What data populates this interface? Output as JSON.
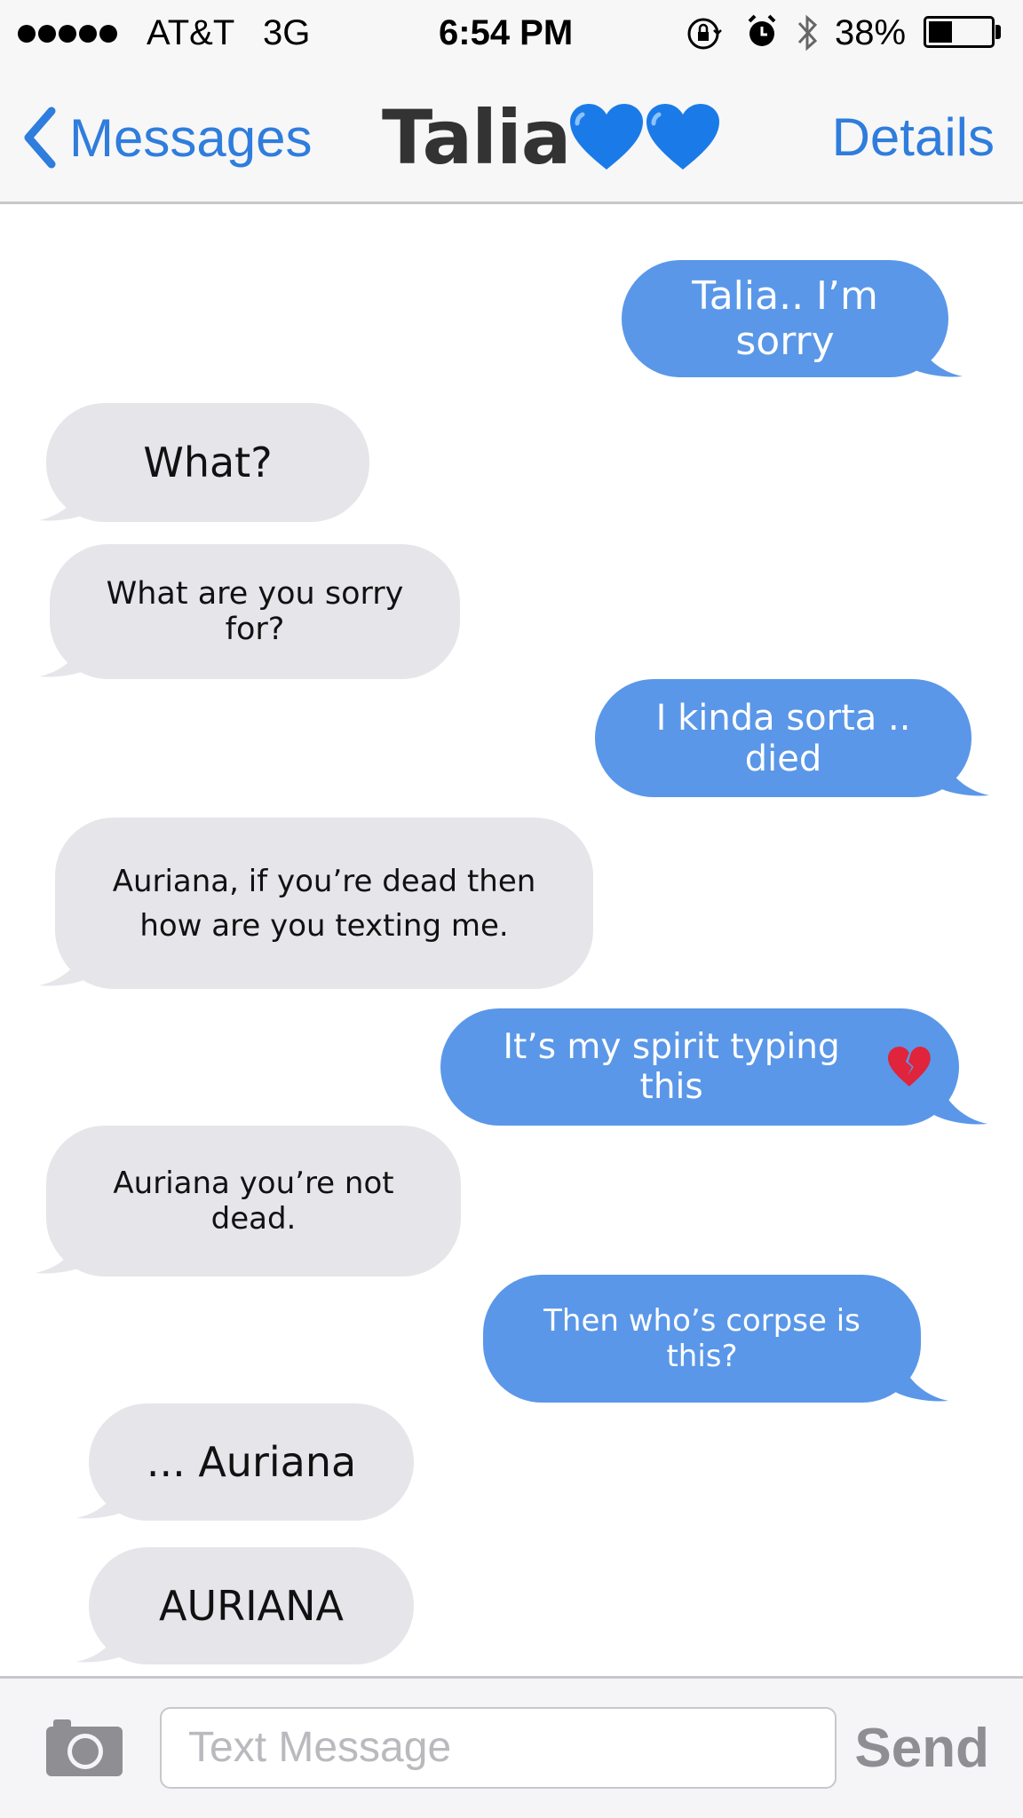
{
  "status_bar": {
    "carrier": "AT&T",
    "network": "3G",
    "time": "6:54 PM",
    "battery_percent": "38%",
    "battery_level": 0.38,
    "icons": [
      "signal-dots-icon",
      "rotation-lock-icon",
      "alarm-icon",
      "bluetooth-icon",
      "battery-icon"
    ]
  },
  "nav": {
    "back_label": "Messages",
    "title": "Talia",
    "title_emoji": "blue-heart-icon x2",
    "details_label": "Details"
  },
  "messages": [
    {
      "direction": "sent",
      "text": "Talia.. I’m sorry"
    },
    {
      "direction": "received",
      "text": "What?"
    },
    {
      "direction": "received",
      "text": "What are you sorry for?"
    },
    {
      "direction": "sent",
      "text": "I kinda sorta .. died"
    },
    {
      "direction": "received",
      "text": "Auriana, if you’re dead then how are you texting me."
    },
    {
      "direction": "sent",
      "text": "It’s my spirit typing this",
      "emoji": "broken-heart-icon"
    },
    {
      "direction": "received",
      "text": "Auriana you’re not dead."
    },
    {
      "direction": "sent",
      "text": "Then who’s corpse is this?"
    },
    {
      "direction": "received",
      "text": "... Auriana"
    },
    {
      "direction": "received",
      "text": "AURIANA"
    }
  ],
  "input_bar": {
    "placeholder": "Text Message",
    "send_label": "Send"
  },
  "colors": {
    "accent_blue": "#2f7ddc",
    "sent_bubble": "#5a97e8",
    "received_bubble": "#e5e5ea",
    "bar_background": "#f7f7f8"
  }
}
